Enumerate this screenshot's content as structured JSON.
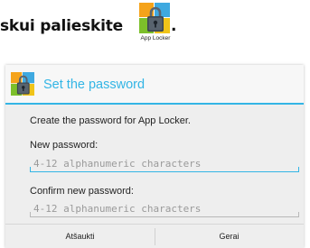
{
  "instruction": {
    "text": "skui palieskite",
    "period": ".",
    "icon": "app-locker-icon",
    "icon_label": "App Locker"
  },
  "dialog": {
    "header_icon": "app-locker-icon",
    "title": "Set the password",
    "description": "Create the password for App Locker.",
    "new_password": {
      "label": "New password:",
      "placeholder": "4-12 alphanumeric characters",
      "value": ""
    },
    "confirm_password": {
      "label": "Confirm new password:",
      "placeholder": "4-12 alphanumeric characters",
      "value": ""
    },
    "buttons": {
      "cancel": "Atšaukti",
      "ok": "Gerai"
    }
  },
  "colors": {
    "accent": "#33b5e5",
    "dialog_background": "#eeeeee"
  }
}
